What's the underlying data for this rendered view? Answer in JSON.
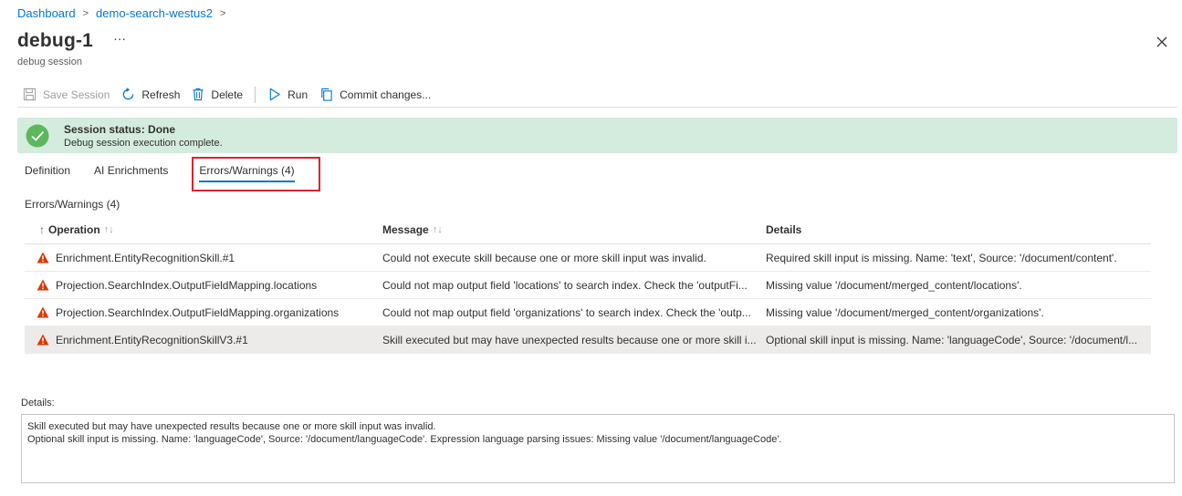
{
  "breadcrumb": {
    "items": [
      "Dashboard",
      "demo-search-westus2"
    ]
  },
  "header": {
    "title": "debug-1",
    "subtitle": "debug session",
    "more": "···"
  },
  "toolbar": {
    "save": "Save Session",
    "refresh": "Refresh",
    "delete": "Delete",
    "run": "Run",
    "commit": "Commit changes..."
  },
  "status": {
    "title": "Session status: Done",
    "description": "Debug session execution complete.",
    "color": "#d4ecdd"
  },
  "tabs": [
    {
      "label": "Definition"
    },
    {
      "label": "AI Enrichments"
    },
    {
      "label": "Errors/Warnings (4)"
    }
  ],
  "section_label": "Errors/Warnings (4)",
  "grid": {
    "columns": {
      "operation": "Operation",
      "message": "Message",
      "details": "Details"
    },
    "rows": [
      {
        "operation": "Enrichment.EntityRecognitionSkill.#1",
        "message": "Could not execute skill because one or more skill input was invalid.",
        "details": "Required skill input is missing. Name: 'text', Source: '/document/content'."
      },
      {
        "operation": "Projection.SearchIndex.OutputFieldMapping.locations",
        "message": "Could not map output field 'locations' to search index. Check the 'outputFi...",
        "details": "Missing value '/document/merged_content/locations'."
      },
      {
        "operation": "Projection.SearchIndex.OutputFieldMapping.organizations",
        "message": "Could not map output field 'organizations' to search index. Check the 'outp...",
        "details": "Missing value '/document/merged_content/organizations'."
      },
      {
        "operation": "Enrichment.EntityRecognitionSkillV3.#1",
        "message": "Skill executed but may have unexpected results because one or more skill i...",
        "details": "Optional skill input is missing. Name: 'languageCode', Source: '/document/l..."
      }
    ]
  },
  "details": {
    "label": "Details:",
    "line1": "Skill executed but may have unexpected results because one or more skill input was invalid.",
    "line2": "Optional skill input is missing. Name: 'languageCode', Source: '/document/languageCode'. Expression language parsing issues: Missing value '/document/languageCode'."
  },
  "colors": {
    "accent": "#0078d4",
    "warning": "#d83b01",
    "highlight": "#d9252b"
  }
}
